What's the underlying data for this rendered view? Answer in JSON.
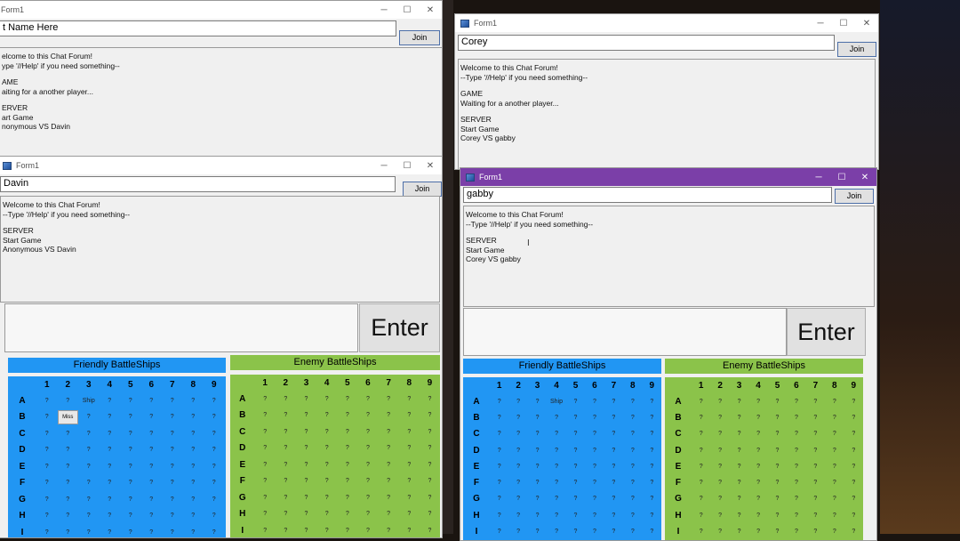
{
  "col_labels": [
    "1",
    "2",
    "3",
    "4",
    "5",
    "6",
    "7",
    "8",
    "9"
  ],
  "row_labels": [
    "A",
    "B",
    "C",
    "D",
    "E",
    "F",
    "G",
    "H",
    "I"
  ],
  "enter_label": "Enter",
  "join_label": "Join",
  "friendly_header": "Friendly BattleShips",
  "enemy_header": "Enemy BattleShips",
  "win_tl": {
    "title": "Form1",
    "name": "t Name Here",
    "lines": [
      "elcome to this Chat Forum!",
      "ype '//Help' if you need something--",
      "",
      "AME",
      "aiting for a another player...",
      "",
      "ERVER",
      "art Game",
      "nonymous VS Davin"
    ]
  },
  "win_tr": {
    "title": "Form1",
    "name": "Corey",
    "lines": [
      "Welcome to this Chat Forum!",
      "--Type '//Help' if you need something--",
      "",
      "GAME",
      "Waiting for a another player...",
      "",
      "SERVER",
      "Start Game",
      "Corey VS gabby"
    ]
  },
  "win_bl": {
    "title": "Form1",
    "name": "Davin",
    "lines": [
      "Welcome to this Chat Forum!",
      "--Type '//Help' if you need something--",
      "",
      "SERVER",
      "Start Game",
      "Anonymous VS Davin"
    ],
    "friendly_cells": {
      "A3": "Ship",
      "B2": "Miss"
    }
  },
  "win_br": {
    "title": "Form1",
    "name": "gabby",
    "lines": [
      "Welcome to this Chat Forum!",
      "--Type '//Help' if you need something--",
      "",
      "SERVER",
      "Start Game",
      "Corey VS gabby"
    ],
    "friendly_cells": {
      "A4": "Ship"
    }
  },
  "colors": {
    "friendly": "#2196f3",
    "enemy": "#8bc34a",
    "active_title": "#7b3fa8"
  }
}
